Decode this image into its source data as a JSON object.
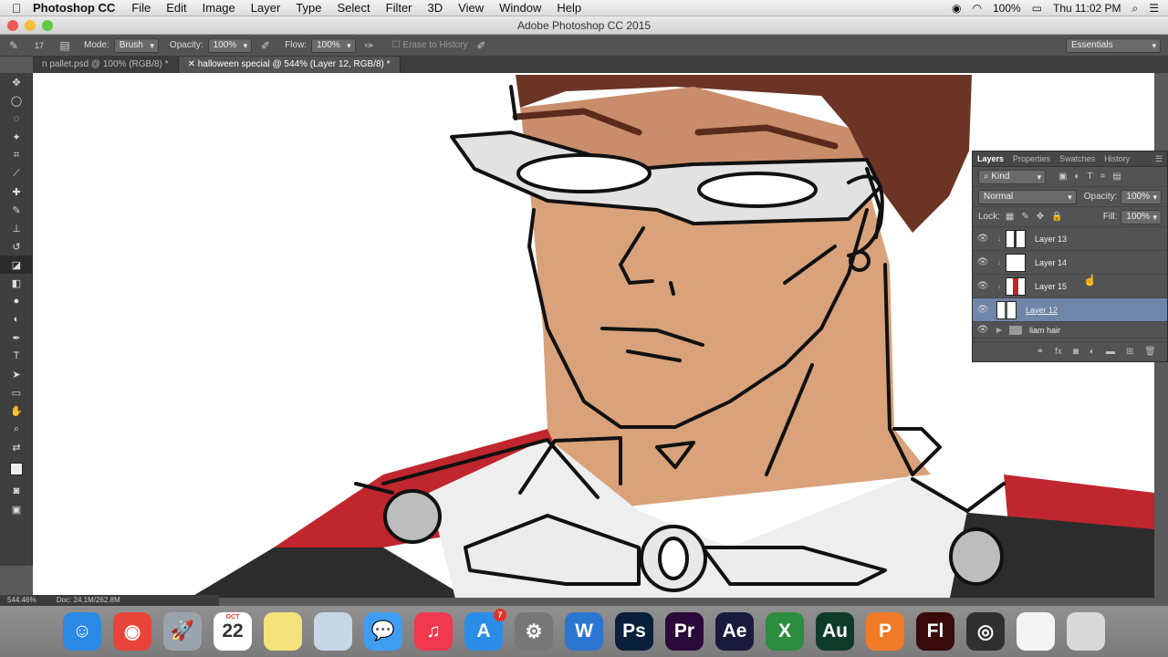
{
  "menubar": {
    "apple": "",
    "app_name": "Photoshop CC",
    "items": [
      "File",
      "Edit",
      "Image",
      "Layer",
      "Type",
      "Select",
      "Filter",
      "3D",
      "View",
      "Window",
      "Help"
    ],
    "battery": "100%",
    "clock": "Thu 11:02 PM"
  },
  "titlebar": {
    "title": "Adobe Photoshop CC 2015"
  },
  "options": {
    "brush_size": "17",
    "mode_label": "Mode:",
    "mode_value": "Brush",
    "opacity_label": "Opacity:",
    "opacity_value": "100%",
    "flow_label": "Flow:",
    "flow_value": "100%",
    "erase_history": "Erase to History",
    "workspace": "Essentials"
  },
  "tabs": [
    {
      "label": "n pallet.psd @ 100% (RGB/8) *"
    },
    {
      "label": "halloween special @ 544% (Layer 12, RGB/8) *"
    }
  ],
  "status": {
    "zoom": "544.46%",
    "doc": "Doc: 24.1M/262.8M"
  },
  "layers_panel": {
    "tabs": [
      "Layers",
      "Properties",
      "Swatches",
      "History"
    ],
    "kind": "Kind",
    "blend_mode": "Normal",
    "opacity_label": "Opacity:",
    "opacity_value": "100%",
    "lock_label": "Lock:",
    "fill_label": "Fill:",
    "fill_value": "100%",
    "layers": [
      {
        "name": "Layer 13",
        "thumb_color": "#333333"
      },
      {
        "name": "Layer 14",
        "thumb_color": "#ffffff"
      },
      {
        "name": "Layer 15",
        "thumb_color": "#c0262e"
      },
      {
        "name": "Layer 12",
        "thumb_color": "#555555",
        "selected": true
      },
      {
        "name": "liam hair",
        "group": true
      }
    ]
  },
  "dock": {
    "apps": [
      {
        "icon": "finder-icon",
        "label": "☺",
        "color": "#2b8ae6"
      },
      {
        "icon": "chrome-icon",
        "label": "◉",
        "color": "#e8443a"
      },
      {
        "icon": "launchpad-icon",
        "label": "🚀",
        "color": "#9aa3ad"
      },
      {
        "icon": "calendar-icon",
        "label": "22",
        "color": "#ffffff",
        "month": "OCT"
      },
      {
        "icon": "notes-icon",
        "label": "",
        "color": "#f6e27a"
      },
      {
        "icon": "preview-icon",
        "label": "",
        "color": "#c8d7e6"
      },
      {
        "icon": "messages-icon",
        "label": "💬",
        "color": "#3f9df2"
      },
      {
        "icon": "itunes-icon",
        "label": "♫",
        "color": "#f0384f"
      },
      {
        "icon": "appstore-icon",
        "label": "A",
        "color": "#2a8ee8",
        "badge": "7"
      },
      {
        "icon": "system-preferences-icon",
        "label": "⚙",
        "color": "#777777"
      },
      {
        "icon": "word-icon",
        "label": "W",
        "color": "#2b76d1"
      },
      {
        "icon": "photoshop-icon",
        "label": "Ps",
        "color": "#0a1f3a"
      },
      {
        "icon": "premiere-icon",
        "label": "Pr",
        "color": "#2a0a3a"
      },
      {
        "icon": "after-effects-icon",
        "label": "Ae",
        "color": "#1a1a3d"
      },
      {
        "icon": "excel-icon",
        "label": "X",
        "color": "#2c8c3f"
      },
      {
        "icon": "audition-icon",
        "label": "Au",
        "color": "#0e3a2a"
      },
      {
        "icon": "pages-icon",
        "label": "P",
        "color": "#f07a25"
      },
      {
        "icon": "flash-icon",
        "label": "Fl",
        "color": "#3a0a0a"
      },
      {
        "icon": "obs-icon",
        "label": "◎",
        "color": "#303030"
      },
      {
        "icon": "document-icon",
        "label": "",
        "color": "#f4f4f4"
      },
      {
        "icon": "trash-icon",
        "label": "",
        "color": "#d9d9d9"
      }
    ]
  },
  "colors": {
    "accent": "#6f86a9",
    "panel": "#535353",
    "red": "#c0262e"
  }
}
